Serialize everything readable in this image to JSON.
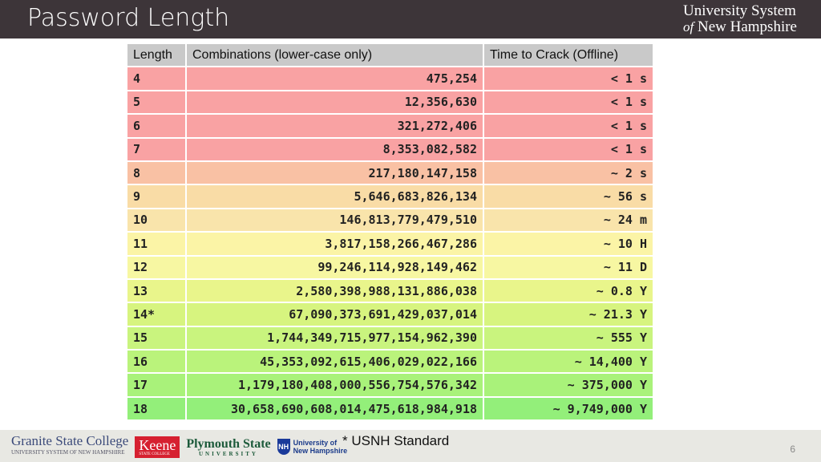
{
  "header": {
    "title": "Password Length",
    "logo_line1": "University System",
    "logo_line2_of": "of",
    "logo_line2": "New Hampshire"
  },
  "table": {
    "columns": [
      "Length",
      "Combinations (lower-case only)",
      "Time to Crack (Offline)"
    ],
    "rows": [
      {
        "length": "4",
        "combinations": "475,254",
        "time": "< 1 s",
        "color": "#f9a2a3"
      },
      {
        "length": "5",
        "combinations": "12,356,630",
        "time": "< 1 s",
        "color": "#f9a2a3"
      },
      {
        "length": "6",
        "combinations": "321,272,406",
        "time": "< 1 s",
        "color": "#f9a2a3"
      },
      {
        "length": "7",
        "combinations": "8,353,082,582",
        "time": "< 1 s",
        "color": "#f9a2a3"
      },
      {
        "length": "8",
        "combinations": "217,180,147,158",
        "time": "~ 2 s",
        "color": "#f9c1a4"
      },
      {
        "length": "9",
        "combinations": "5,646,683,826,134",
        "time": "~ 56 s",
        "color": "#f9dca6"
      },
      {
        "length": "10",
        "combinations": "146,813,779,479,510",
        "time": "~ 24 m",
        "color": "#f9e4ab"
      },
      {
        "length": "11",
        "combinations": "3,817,158,266,467,286",
        "time": "~ 10 H",
        "color": "#fbf4a6"
      },
      {
        "length": "12",
        "combinations": "99,246,114,928,149,462",
        "time": "~ 11 D",
        "color": "#f7f7a2"
      },
      {
        "length": "13",
        "combinations": "2,580,398,988,131,886,038",
        "time": "~ 0.8 Y",
        "color": "#e9f58b"
      },
      {
        "length": "14*",
        "combinations": "67,090,373,691,429,037,014",
        "time": "~ 21.3 Y",
        "color": "#d7f47f"
      },
      {
        "length": "15",
        "combinations": "1,744,349,715,977,154,962,390",
        "time": "~ 555 Y",
        "color": "#c9f47e"
      },
      {
        "length": "16",
        "combinations": "45,353,092,615,406,029,022,166",
        "time": "~ 14,400 Y",
        "color": "#baf37b"
      },
      {
        "length": "17",
        "combinations": "1,179,180,408,000,556,754,576,342",
        "time": "~ 375,000 Y",
        "color": "#a9f27a"
      },
      {
        "length": "18",
        "combinations": "30,658,690,608,014,475,618,984,918",
        "time": "~ 9,749,000 Y",
        "color": "#93ef7a"
      }
    ]
  },
  "footer": {
    "note": "* USNH Standard",
    "page": "6",
    "logos": {
      "gsc": "Granite State College",
      "gsc_sub": "UNIVERSITY SYSTEM OF NEW HAMPSHIRE",
      "keene": "Keene",
      "keene_sub": "STATE COLLEGE",
      "psu": "Plymouth State",
      "psu_sub": "UNIVERSITY",
      "unh_mark": "NH",
      "unh1": "University of",
      "unh2": "New Hampshire"
    }
  }
}
